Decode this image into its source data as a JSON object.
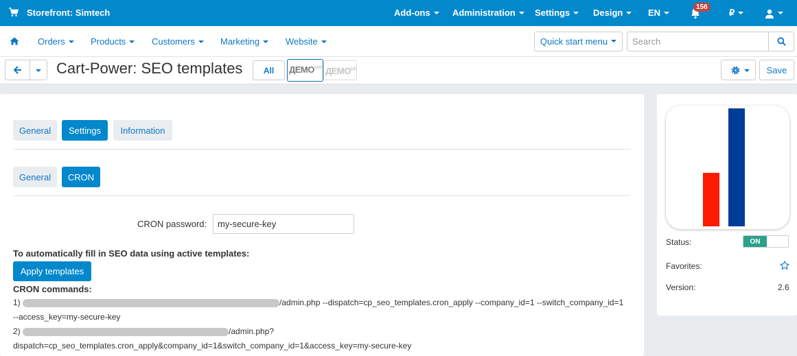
{
  "topbar": {
    "store": "Storefront: Simtech",
    "menus": [
      "Add-ons",
      "Administration",
      "Settings",
      "Design",
      "EN"
    ],
    "notifications": "156",
    "currency": "₽"
  },
  "subnav": {
    "items": [
      "Orders",
      "Products",
      "Customers",
      "Marketing",
      "Website"
    ],
    "quick_start": "Quick start menu",
    "search_placeholder": "Search"
  },
  "header": {
    "title": "Cart-Power: SEO templates",
    "all_label": "All",
    "demo_logo": "ДЕМО",
    "demo_logo_small": "МАГ",
    "save_label": "Save"
  },
  "tabs": {
    "primary": [
      "General",
      "Settings",
      "Information"
    ],
    "secondary": [
      "General",
      "CRON"
    ]
  },
  "form": {
    "cron_password_label": "CRON password:",
    "cron_password_value": "my-secure-key",
    "autofill_text": "To automatically fill in SEO data using active templates:",
    "apply_button": "Apply templates",
    "cron_commands_label": "CRON commands:",
    "cmd1_prefix": "1)",
    "cmd1_text": "/admin.php --dispatch=cp_seo_templates.cron_apply --company_id=1 --switch_company_id=1",
    "cmd1_cont": "--access_key=my-secure-key",
    "cmd2_prefix": "2)",
    "cmd2_text": "/admin.php?",
    "cmd2_cont": "dispatch=cp_seo_templates.cron_apply&company_id=1&switch_company_id=1&access_key=my-secure-key"
  },
  "sidebar": {
    "status_label": "Status:",
    "status_value": "ON",
    "favorites_label": "Favorites:",
    "version_label": "Version:",
    "version_value": "2.6"
  },
  "colors": {
    "topbar": "#0388cc",
    "link": "#0e78c4",
    "logo_red": "#ff1a00",
    "logo_blue": "#003d99",
    "toggle_on": "#2ca18b"
  }
}
